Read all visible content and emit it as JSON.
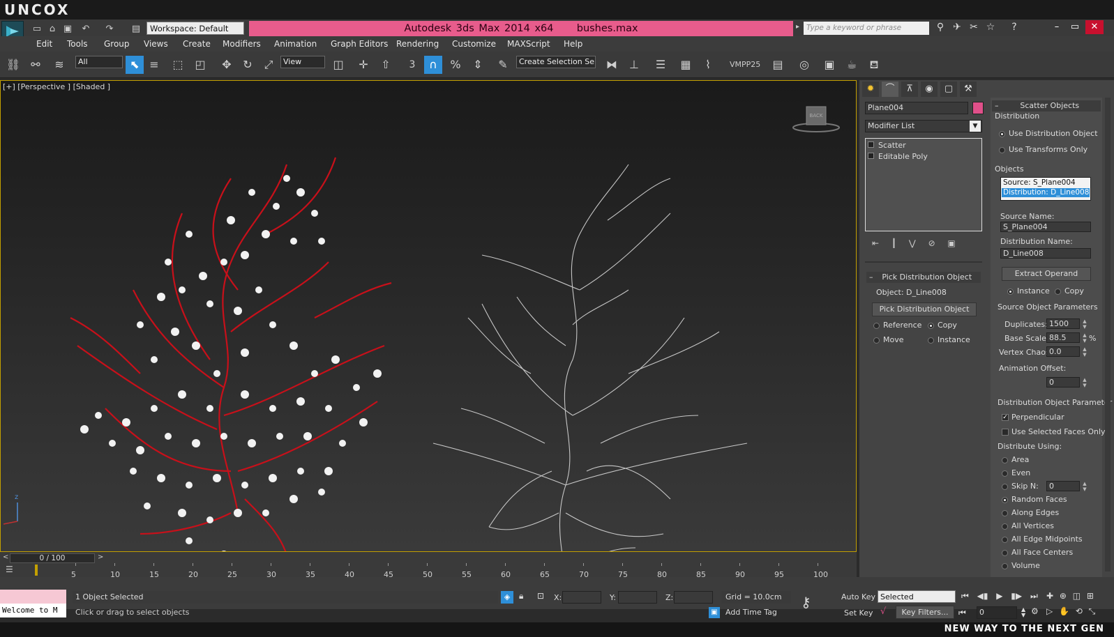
{
  "brand": "UNCOX",
  "titlebar": {
    "workspace": "Workspace: Default",
    "app_title": "Autodesk 3ds Max  2014 x64",
    "file_name": "bushes.max",
    "search_placeholder": "Type a keyword or phrase"
  },
  "menus": [
    "Edit",
    "Tools",
    "Group",
    "Views",
    "Create",
    "Modifiers",
    "Animation",
    "Graph Editors",
    "Rendering",
    "Customize",
    "MAXScript",
    "Help"
  ],
  "toolbar": {
    "filter": "All",
    "coord_system": "View",
    "selection_set": "Create Selection Se",
    "snap_label": "3",
    "vmpp": "VMPP25"
  },
  "viewport": {
    "label": "[+] [Perspective ] [Shaded ]",
    "viewcube_label": "BACK",
    "axis_z": "z"
  },
  "command_panel": {
    "object_name": "Plane004",
    "modifier_list": "Modifier List",
    "stack": [
      "Scatter",
      "Editable Poly"
    ],
    "pick_rollout": {
      "title": "Pick Distribution Object",
      "object": "Object: D_Line008",
      "button": "Pick Distribution Object",
      "options": [
        "Reference",
        "Copy",
        "Move",
        "Instance"
      ]
    }
  },
  "scatter_panel": {
    "title": "Scatter Objects",
    "distribution_label": "Distribution",
    "distribution_options": [
      "Use Distribution Object",
      "Use Transforms Only"
    ],
    "objects_label": "Objects",
    "objects_list": [
      "Source: S_Plane004",
      "Distribution: D_Line008"
    ],
    "source_name_label": "Source Name:",
    "source_name": "S_Plane004",
    "distribution_name_label": "Distribution Name:",
    "distribution_name": "D_Line008",
    "extract_button": "Extract Operand",
    "extract_options": [
      "Instance",
      "Copy"
    ],
    "source_params_label": "Source Object Parameters",
    "duplicates_label": "Duplicates:",
    "duplicates": "1500",
    "base_scale_label": "Base Scale:",
    "base_scale": "88.5",
    "percent": "%",
    "vertex_chaos_label": "Vertex Chaos:",
    "vertex_chaos": "0.0",
    "anim_offset_label": "Animation Offset:",
    "anim_offset": "0",
    "dist_params_label": "Distribution Object Parameter",
    "perpendicular": "Perpendicular",
    "use_selected_faces": "Use Selected Faces Only",
    "distribute_using": "Distribute Using:",
    "distribute_options": [
      "Area",
      "Even",
      "Skip N:",
      "Random Faces",
      "Along Edges",
      "All Vertices",
      "All Edge Midpoints",
      "All Face Centers",
      "Volume"
    ],
    "skip_n_value": "0",
    "selected_distribute": "Random Faces"
  },
  "timeline": {
    "frame": "0 / 100",
    "ticks": [
      "5",
      "10",
      "15",
      "20",
      "25",
      "30",
      "35",
      "40",
      "45",
      "50",
      "55",
      "60",
      "65",
      "70",
      "75",
      "80",
      "85",
      "90",
      "95",
      "100"
    ]
  },
  "status": {
    "selected": "1 Object Selected",
    "prompt": "Click or drag to select objects",
    "welcome": "Welcome to M",
    "x_label": "X:",
    "y_label": "Y:",
    "z_label": "Z:",
    "grid": "Grid = 10.0cm",
    "add_time_tag": "Add Time Tag",
    "auto_key": "Auto Key",
    "set_key": "Set Key",
    "key_mode": "Selected",
    "key_filters": "Key Filters...",
    "frame_field": "0"
  },
  "tagline": "NEW WAY TO THE NEXT GEN",
  "colors": {
    "title_accent": "#e85c8c",
    "bush_red": "#c8101a",
    "selection_blue": "#2e8fd8",
    "viewport_border": "#c3a000"
  }
}
